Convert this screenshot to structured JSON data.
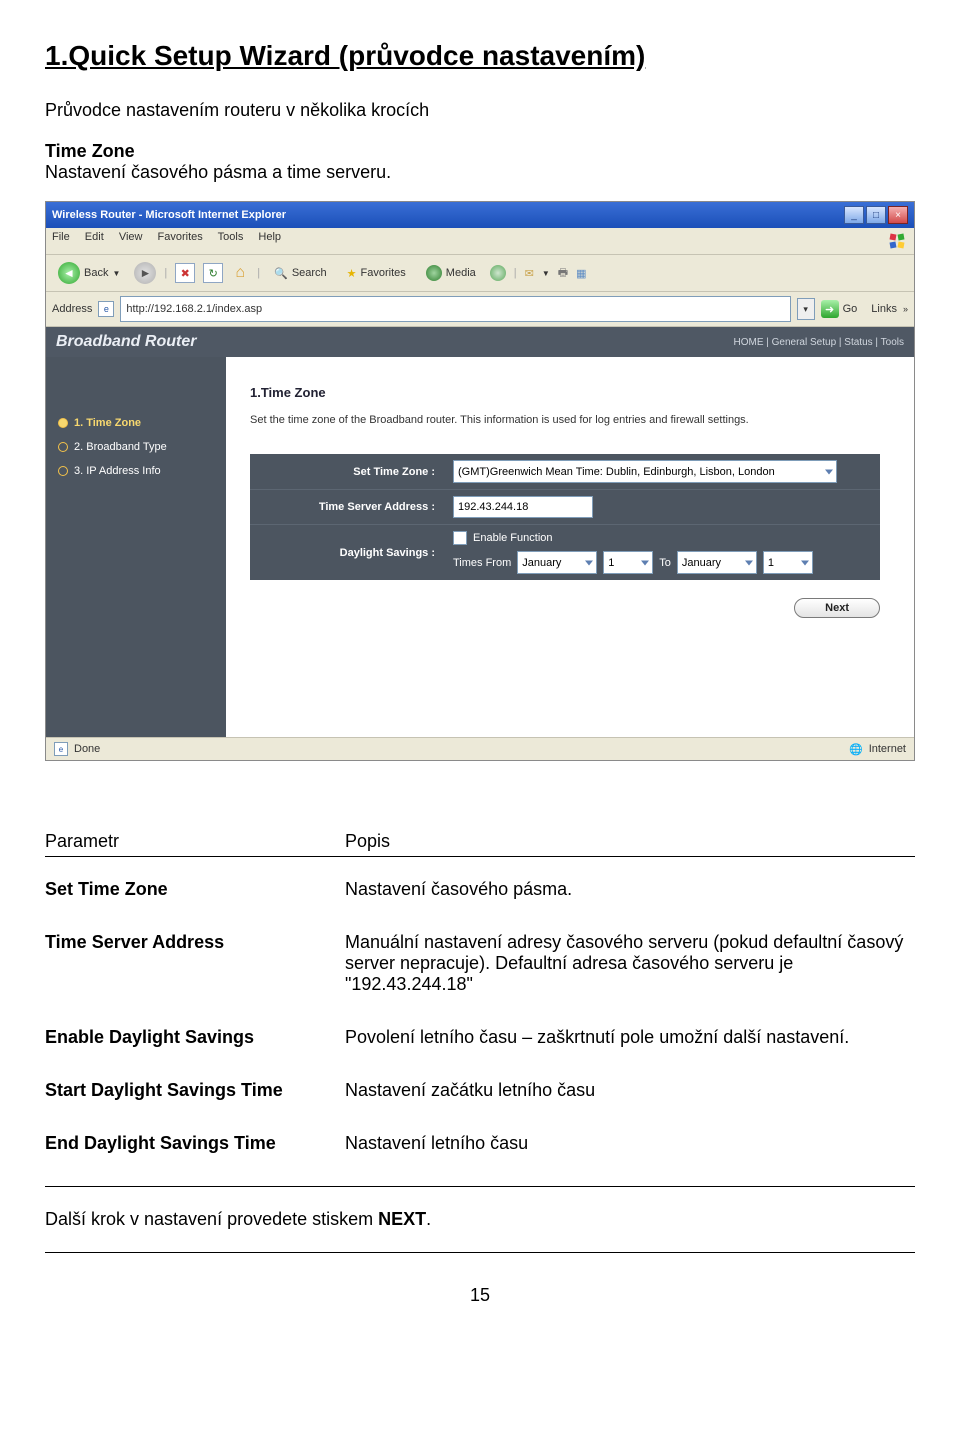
{
  "heading": "1.Quick Setup Wizard (průvodce nastavením)",
  "intro": "Průvodce nastavením routeru v několika krocích",
  "section": {
    "title": "Time Zone",
    "desc": "Nastavení časového pásma a time serveru."
  },
  "browser": {
    "title": "Wireless Router - Microsoft Internet Explorer",
    "menus": [
      "File",
      "Edit",
      "View",
      "Favorites",
      "Tools",
      "Help"
    ],
    "toolbar": {
      "back": "Back",
      "search": "Search",
      "favorites": "Favorites",
      "media": "Media"
    },
    "address_label": "Address",
    "address": "http://192.168.2.1/index.asp",
    "go": "Go",
    "links": "Links",
    "status_left": "Done",
    "status_right": "Internet"
  },
  "router_ui": {
    "brand": "Broadband Router",
    "nav": [
      "HOME",
      "General Setup",
      "Status",
      "Tools"
    ],
    "side_items": [
      {
        "label": "1. Time Zone",
        "active": true
      },
      {
        "label": "2. Broadband Type",
        "active": false
      },
      {
        "label": "3. IP Address Info",
        "active": false
      }
    ],
    "content_title": "1.Time Zone",
    "content_desc": "Set the time zone of the Broadband router. This information is used for log entries and firewall settings.",
    "form": {
      "set_tz_label": "Set Time Zone :",
      "set_tz_value": "(GMT)Greenwich Mean Time: Dublin, Edinburgh, Lisbon, London",
      "tsa_label": "Time Server Address :",
      "tsa_value": "192.43.244.18",
      "ds_label": "Daylight Savings :",
      "ds_enable": "Enable Function",
      "ds_from": "Times From",
      "ds_to": "To",
      "month1": "January",
      "day1": "1",
      "month2": "January",
      "day2": "1"
    },
    "next": "Next"
  },
  "param_table": {
    "col1": "Parametr",
    "col2": "Popis",
    "rows": [
      {
        "label": "Set Time Zone",
        "desc": "Nastavení časového pásma."
      },
      {
        "label": "Time Server Address",
        "desc": "Manuální nastavení adresy časového serveru (pokud defaultní časový server nepracuje). Defaultní adresa časového serveru je \"192.43.244.18\""
      },
      {
        "label": "Enable Daylight Savings",
        "desc": "Povolení letního času – zaškrtnutí pole umožní další nastavení."
      },
      {
        "label": "Start Daylight Savings Time",
        "desc": "Nastavení začátku letního času"
      },
      {
        "label": "End Daylight Savings Time",
        "desc": "Nastavení letního času"
      }
    ]
  },
  "next_note_prefix": "Další krok v nastavení provedete stiskem ",
  "next_note_bold": "NEXT",
  "next_note_suffix": ".",
  "page_number": "15"
}
